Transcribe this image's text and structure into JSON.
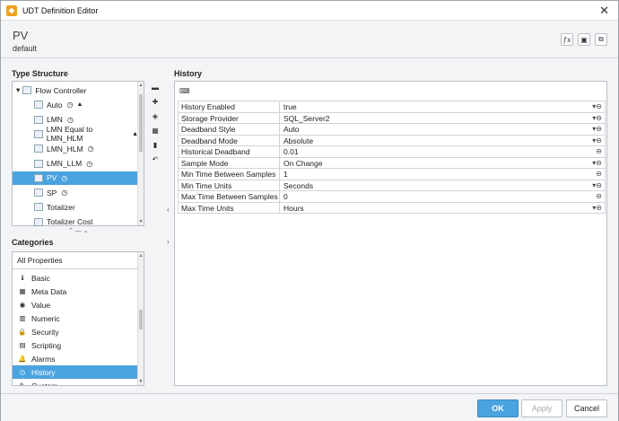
{
  "window": {
    "title": "UDT Definition Editor",
    "app_icon": "ignition-icon"
  },
  "header": {
    "tag_name": "PV",
    "tag_sub": "default",
    "buttons": [
      "expression-icon",
      "editor-icon",
      "copy-icon"
    ]
  },
  "type_structure": {
    "label": "Type Structure",
    "items": [
      {
        "label": "Flow Controller",
        "clock": false,
        "alarm": false
      },
      {
        "label": "Auto",
        "clock": true,
        "alarm": true
      },
      {
        "label": "LMN",
        "clock": true,
        "alarm": false
      },
      {
        "label": "LMN Equal to LMN_HLM",
        "clock": false,
        "alarm": true
      },
      {
        "label": "LMN_HLM",
        "clock": true,
        "alarm": false
      },
      {
        "label": "LMN_LLM",
        "clock": true,
        "alarm": false
      },
      {
        "label": "PV",
        "clock": true,
        "alarm": false,
        "selected": true
      },
      {
        "label": "SP",
        "clock": true,
        "alarm": false
      },
      {
        "label": "Totalizer",
        "clock": false,
        "alarm": false
      },
      {
        "label": "Totalizer Cost",
        "clock": false,
        "alarm": false
      }
    ]
  },
  "categories": {
    "label": "Categories",
    "all_label": "All Properties",
    "items": [
      {
        "label": "Basic",
        "icon": "info-icon",
        "glyph": "ℹ"
      },
      {
        "label": "Meta Data",
        "icon": "metadata-icon",
        "glyph": "▦"
      },
      {
        "label": "Value",
        "icon": "value-icon",
        "glyph": "◉"
      },
      {
        "label": "Numeric",
        "icon": "numeric-icon",
        "glyph": "▥"
      },
      {
        "label": "Security",
        "icon": "lock-icon",
        "glyph": "🔒"
      },
      {
        "label": "Scripting",
        "icon": "script-icon",
        "glyph": "▤"
      },
      {
        "label": "Alarms",
        "icon": "bell-icon",
        "glyph": "🔔"
      },
      {
        "label": "History",
        "icon": "clock-icon",
        "glyph": "◷",
        "selected": true
      },
      {
        "label": "Custom",
        "icon": "custom-icon",
        "glyph": "✎"
      }
    ]
  },
  "history": {
    "label": "History",
    "rows": [
      {
        "key": "History Enabled",
        "value": "true",
        "dropdown": true
      },
      {
        "key": "Storage Provider",
        "value": "SQL_Server2",
        "dropdown": true
      },
      {
        "key": "Deadband Style",
        "value": "Auto",
        "dropdown": true
      },
      {
        "key": "Deadband Mode",
        "value": "Absolute",
        "dropdown": true
      },
      {
        "key": "Historical Deadband",
        "value": "0.01",
        "dropdown": false
      },
      {
        "key": "Sample Mode",
        "value": "On Change",
        "dropdown": true
      },
      {
        "key": "Min Time Between Samples",
        "value": "1",
        "dropdown": false
      },
      {
        "key": "Min Time Units",
        "value": "Seconds",
        "dropdown": true
      },
      {
        "key": "Max Time Between Samples",
        "value": "0",
        "dropdown": false
      },
      {
        "key": "Max Time Units",
        "value": "Hours",
        "dropdown": true
      }
    ]
  },
  "footer": {
    "ok": "OK",
    "apply": "Apply",
    "cancel": "Cancel"
  }
}
